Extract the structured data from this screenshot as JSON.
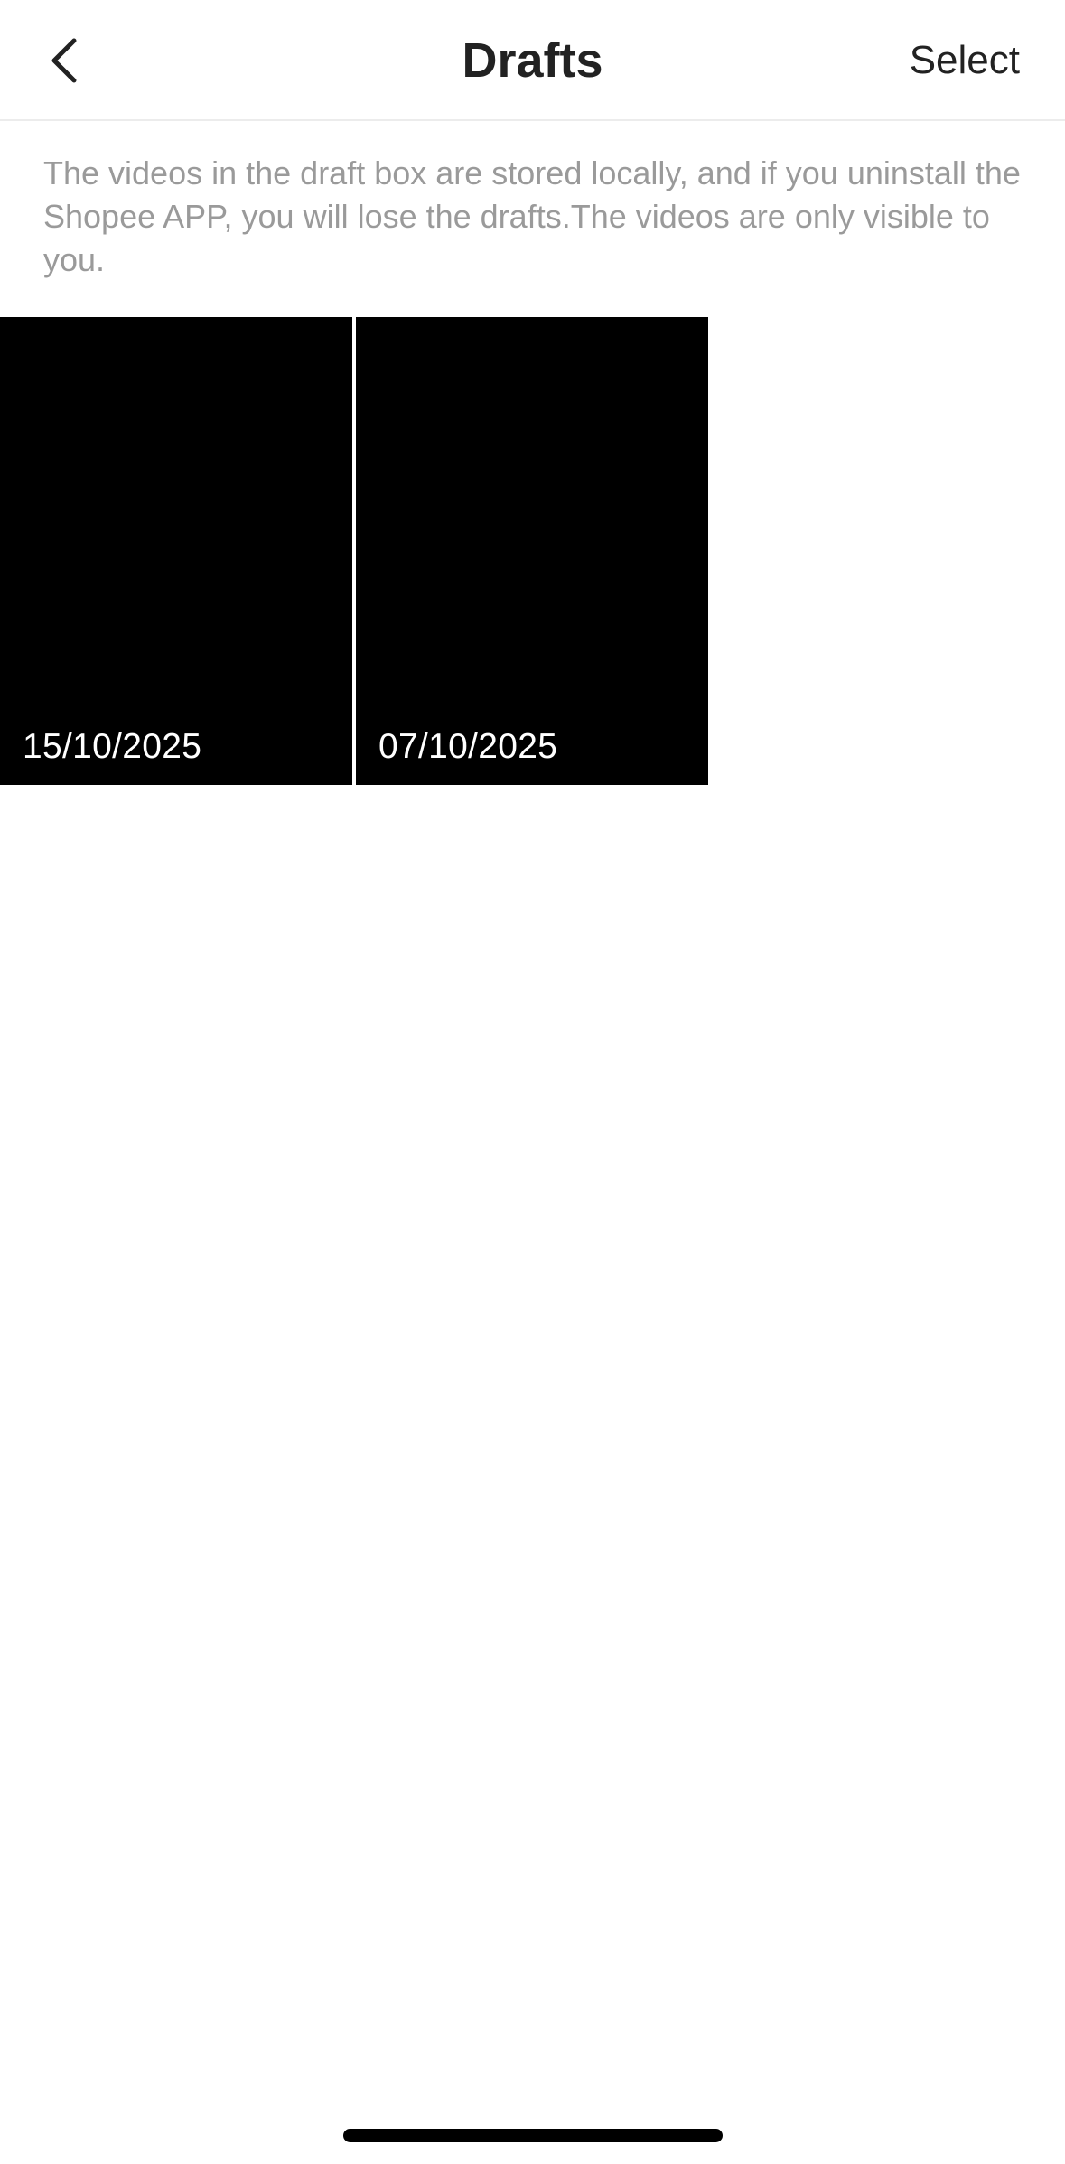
{
  "header": {
    "title": "Drafts",
    "select_label": "Select",
    "back_icon": "chevron-left-icon"
  },
  "notice": {
    "text": "The videos in the draft box are stored locally, and if you uninstall the Shopee APP, you will lose the drafts.The videos are only visible to you."
  },
  "drafts": [
    {
      "date": "15/10/2025"
    },
    {
      "date": "07/10/2025"
    }
  ],
  "colors": {
    "background": "#ffffff",
    "title_text": "#222222",
    "notice_text": "#9a9a9a",
    "thumbnail": "#000000",
    "thumbnail_text": "#ffffff"
  }
}
